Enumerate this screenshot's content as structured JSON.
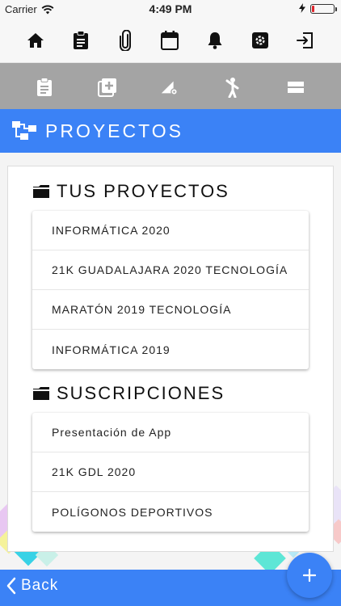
{
  "status_bar": {
    "carrier": "Carrier",
    "time": "4:49 PM"
  },
  "toolbar": {
    "icons": [
      "home-icon",
      "clipboard-icon",
      "paperclip-icon",
      "calendar-icon",
      "bell-icon",
      "settings-icon",
      "logout-icon"
    ]
  },
  "subbar": {
    "icons": [
      "clipboard-list-icon",
      "add-square-icon",
      "edit-settings-icon",
      "person-icon",
      "menu-icon"
    ]
  },
  "header": {
    "title": "PROYECTOS",
    "icon": "sitemap-icon"
  },
  "projects": {
    "title": "TUS PROYECTOS",
    "items": [
      {
        "label": "INFORMÁTICA 2020"
      },
      {
        "label": "21K GUADALAJARA 2020 TECNOLOGÍA"
      },
      {
        "label": "MARATÓN 2019 TECNOLOGÍA"
      },
      {
        "label": "INFORMÁTICA 2019"
      }
    ]
  },
  "subscriptions": {
    "title": "SUSCRIPCIONES",
    "items": [
      {
        "label": "Presentación de App"
      },
      {
        "label": "21K GDL 2020"
      },
      {
        "label": "POLÍGONOS DEPORTIVOS"
      }
    ]
  },
  "footer": {
    "back_label": "Back",
    "fab_label": "+"
  },
  "colors": {
    "primary": "#3b82f6",
    "subbar": "#a4a4a4",
    "toolbar": "#f7f7f7"
  }
}
